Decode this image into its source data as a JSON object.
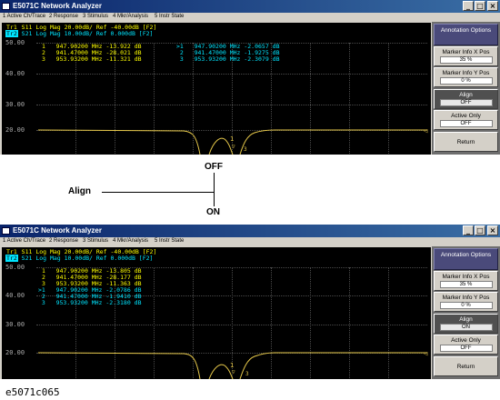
{
  "window_title": "E5071C Network Analyzer",
  "window_buttons": {
    "minimize": "_",
    "maximize": "□",
    "close": "×"
  },
  "menu": [
    "1 Active Ch/Trace",
    "2 Response",
    "3 Stimulus",
    "4 Mkr/Analysis",
    "5 Instr State"
  ],
  "traces": [
    {
      "tag": "Tr1",
      "text": "S11 Log Mag 20.00dB/ Ref -40.00dB [F2]",
      "color": "#ffff00"
    },
    {
      "tag": "Tr2",
      "text": "S21 Log Mag 10.00dB/ Ref 0.000dB [F2]",
      "color": "#00e5ff"
    }
  ],
  "y_ticks": [
    "50.00",
    "40.00",
    "30.00",
    "20.00"
  ],
  "top_panel": {
    "markers_left": [
      "1   947.90200 MHz -13.922 dB",
      "2   941.47000 MHz -28.021 dB",
      "3   953.93200 MHz -11.321 dB"
    ],
    "markers_right": [
      ">1   947.90200 MHz -2.0657 dB",
      " 2   941.47000 MHz -1.9275 dB",
      " 3   953.93200 MHz -2.3079 dB"
    ]
  },
  "bottom_panel": {
    "markers_yellow": [
      "1   947.90200 MHz -13.805 dB",
      "2   941.47000 MHz -28.177 dB",
      "3   953.93200 MHz -11.363 dB"
    ],
    "markers_cyan": [
      ">1   947.90200 MHz -2.0786 dB",
      " 2   941.47000 MHz -1.9410 dB",
      " 3   953.93200 MHz -2.3180 dB"
    ]
  },
  "softkeys_top": [
    {
      "label": "Annotation Options",
      "value": "",
      "style": "head"
    },
    {
      "label": "Marker Info X Pos",
      "value": "35 %",
      "style": "normal"
    },
    {
      "label": "Marker Info Y Pos",
      "value": "0 %",
      "style": "normal"
    },
    {
      "label": "Align",
      "value": "OFF",
      "style": "dark"
    },
    {
      "label": "Active Only",
      "value": "OFF",
      "style": "normal"
    },
    {
      "label": "Return",
      "value": "",
      "style": "normal"
    }
  ],
  "softkeys_bottom": [
    {
      "label": "Annotation Options",
      "value": "",
      "style": "head"
    },
    {
      "label": "Marker Info X Pos",
      "value": "35 %",
      "style": "normal"
    },
    {
      "label": "Marker Info Y Pos",
      "value": "0 %",
      "style": "normal"
    },
    {
      "label": "Align",
      "value": "ON",
      "style": "dark"
    },
    {
      "label": "Active Only",
      "value": "OFF",
      "style": "normal"
    },
    {
      "label": "Return",
      "value": "",
      "style": "normal"
    }
  ],
  "annotation": {
    "label": "Align",
    "off": "OFF",
    "on": "ON"
  },
  "caption": "e5071c065"
}
